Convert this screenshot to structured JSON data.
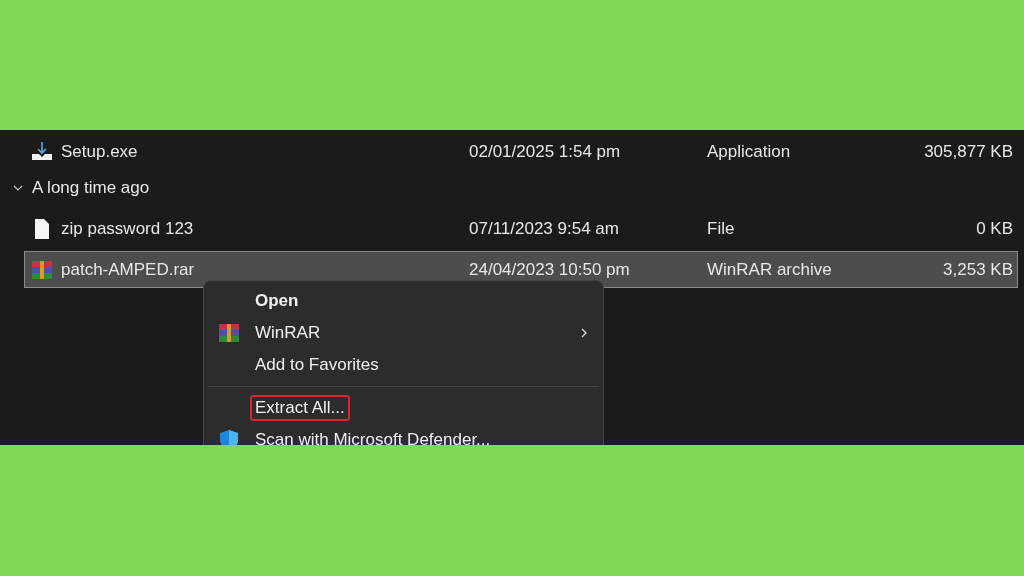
{
  "rows": [
    {
      "kind": "installer",
      "name": "Setup.exe",
      "date": "02/01/2025 1:54 pm",
      "type": "Application",
      "size": "305,877 KB",
      "selected": false
    },
    {
      "kind": "group",
      "name": "A long time ago",
      "expanded": true
    },
    {
      "kind": "document",
      "name": "zip password 123",
      "date": "07/11/2023 9:54 am",
      "type": "File",
      "size": "0 KB",
      "selected": false
    },
    {
      "kind": "archive",
      "name": "patch-AMPED.rar",
      "date": "24/04/2023 10:50 pm",
      "type": "WinRAR archive",
      "size": "3,253 KB",
      "selected": true
    }
  ],
  "context_menu": {
    "items": [
      {
        "kind": "plain",
        "label": "Open",
        "bold": true,
        "submenu": false,
        "highlighted": false
      },
      {
        "kind": "archive",
        "label": "WinRAR",
        "bold": false,
        "submenu": true,
        "highlighted": false
      },
      {
        "kind": "plain",
        "label": "Add to Favorites",
        "bold": false,
        "submenu": false,
        "highlighted": false
      },
      {
        "kind": "separator"
      },
      {
        "kind": "plain",
        "label": "Extract All...",
        "bold": false,
        "submenu": false,
        "highlighted": true
      },
      {
        "kind": "shield",
        "label": "Scan with Microsoft Defender...",
        "bold": false,
        "submenu": false,
        "highlighted": false
      }
    ]
  }
}
